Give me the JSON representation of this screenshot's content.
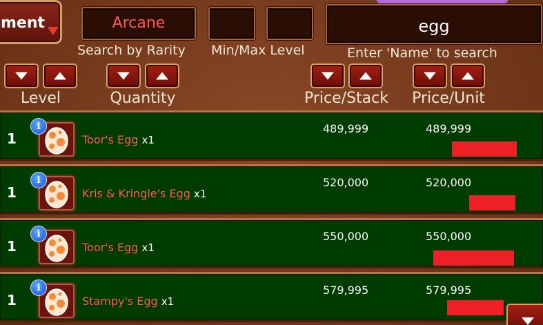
{
  "category": {
    "label": "ment"
  },
  "filters": {
    "rarity_value": "Arcane",
    "rarity_caption": "Search by Rarity",
    "min_level_value": "",
    "max_level_value": "",
    "level_caption": "Min/Max Level",
    "name_value": "egg",
    "name_caption": "Enter 'Name' to search"
  },
  "sort": {
    "level_label": "Level",
    "quantity_label": "Quantity",
    "price_stack_label": "Price/Stack",
    "price_unit_label": "Price/Unit"
  },
  "listings": [
    {
      "level": "1",
      "name": "Toor's Egg",
      "qty": "x1",
      "price_stack": "489,999",
      "price_unit": "489,999"
    },
    {
      "level": "1",
      "name": "Kris & Kringle's Egg",
      "qty": "x1",
      "price_stack": "520,000",
      "price_unit": "520,000"
    },
    {
      "level": "1",
      "name": "Toor's Egg",
      "qty": "x1",
      "price_stack": "550,000",
      "price_unit": "550,000"
    },
    {
      "level": "1",
      "name": "Stampy's Egg",
      "qty": "x1",
      "price_stack": "579,995",
      "price_unit": "579,995"
    }
  ],
  "icons": {
    "info": "info-icon",
    "egg": "egg-icon",
    "sort_down": "arrow-down-icon",
    "sort_up": "arrow-up-icon"
  },
  "colors": {
    "row_bg": "#003b00",
    "item_name": "#ff5a55",
    "rarity_text": "#ff5a55",
    "redaction": "#ee1f25"
  }
}
